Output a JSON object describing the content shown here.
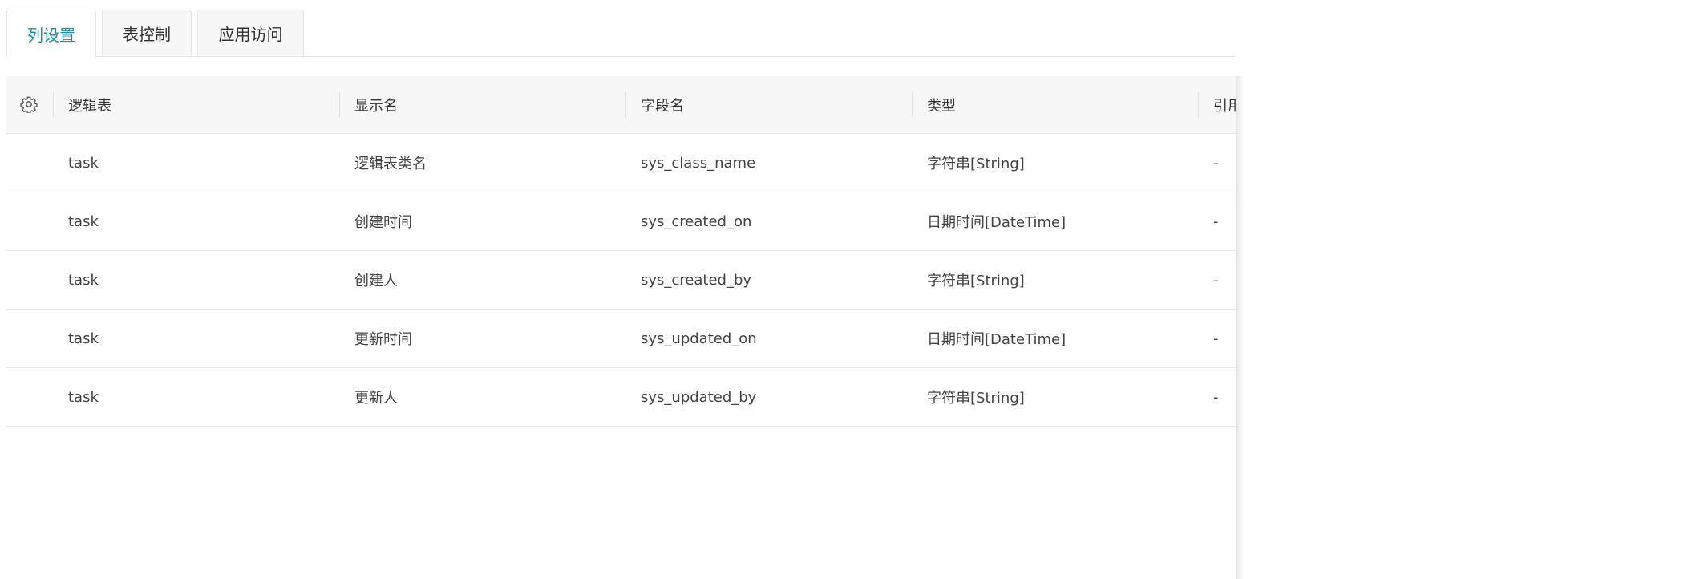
{
  "tabs": [
    "列设置",
    "表控制",
    "应用访问"
  ],
  "active_tab": 0,
  "columns": [
    "逻辑表",
    "显示名",
    "字段名",
    "类型",
    "引用"
  ],
  "rows": [
    {
      "table": "task",
      "display": "逻辑表类名",
      "field": "sys_class_name",
      "type": "字符串[String]",
      "ref": "-"
    },
    {
      "table": "task",
      "display": "创建时间",
      "field": "sys_created_on",
      "type": "日期时间[DateTime]",
      "ref": "-"
    },
    {
      "table": "task",
      "display": "创建人",
      "field": "sys_created_by",
      "type": "字符串[String]",
      "ref": "-"
    },
    {
      "table": "task",
      "display": "更新时间",
      "field": "sys_updated_on",
      "type": "日期时间[DateTime]",
      "ref": "-"
    },
    {
      "table": "task",
      "display": "更新人",
      "field": "sys_updated_by",
      "type": "字符串[String]",
      "ref": "-"
    }
  ],
  "icons": {
    "settings": "gear-icon"
  },
  "colors": {
    "accent": "#1a91aa",
    "header_bg": "#f7f7f7",
    "border": "#e6e6e6"
  }
}
